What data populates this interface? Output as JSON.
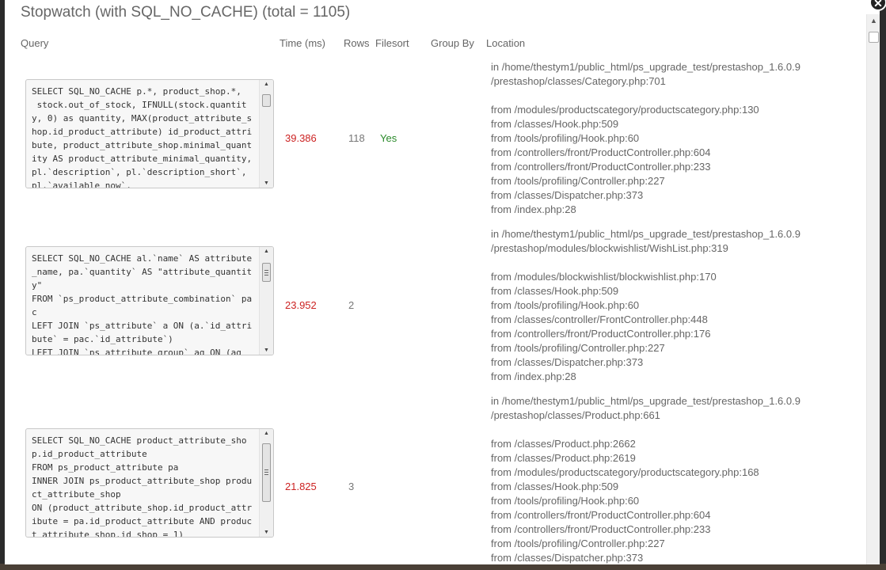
{
  "title": "Stopwatch (with SQL_NO_CACHE) (total = 1105)",
  "headers": {
    "query": "Query",
    "time": "Time (ms)",
    "rows": "Rows",
    "filesort": "Filesort",
    "group_by": "Group By",
    "location": "Location"
  },
  "entries": [
    {
      "sql": "SELECT SQL_NO_CACHE p.*, product_shop.*,\n stock.out_of_stock, IFNULL(stock.quantity, 0) as quantity, MAX(product_attribute_shop.id_product_attribute) id_product_attribute, product_attribute_shop.minimal_quantity AS product_attribute_minimal_quantity, pl.`description`, pl.`description_short`, pl.`available_now`,",
      "time": "39.386",
      "rows": "118",
      "filesort": "Yes",
      "group_by": "",
      "location": "in /home/thestym1/public_html/ps_upgrade_test/prestashop_1.6.0.9\n/prestashop/classes/Category.php:701\n\nfrom /modules/productscategory/productscategory.php:130\nfrom /classes/Hook.php:509\nfrom /tools/profiling/Hook.php:60\nfrom /controllers/front/ProductController.php:604\nfrom /controllers/front/ProductController.php:233\nfrom /tools/profiling/Controller.php:227\nfrom /classes/Dispatcher.php:373\nfrom /index.php:28"
    },
    {
      "sql": "SELECT SQL_NO_CACHE al.`name` AS attribute_name, pa.`quantity` AS \"attribute_quantity\"\nFROM `ps_product_attribute_combination` pac\nLEFT JOIN `ps_attribute` a ON (a.`id_attribute` = pac.`id_attribute`)\nLEFT JOIN `ps_attribute_group` ag ON (ag",
      "time": "23.952",
      "rows": "2",
      "filesort": "",
      "group_by": "",
      "location": "in /home/thestym1/public_html/ps_upgrade_test/prestashop_1.6.0.9\n/prestashop/modules/blockwishlist/WishList.php:319\n\nfrom /modules/blockwishlist/blockwishlist.php:170\nfrom /classes/Hook.php:509\nfrom /tools/profiling/Hook.php:60\nfrom /classes/controller/FrontController.php:448\nfrom /controllers/front/ProductController.php:176\nfrom /tools/profiling/Controller.php:227\nfrom /classes/Dispatcher.php:373\nfrom /index.php:28"
    },
    {
      "sql": "SELECT SQL_NO_CACHE product_attribute_shop.id_product_attribute\nFROM ps_product_attribute pa\nINNER JOIN ps_product_attribute_shop product_attribute_shop\nON (product_attribute_shop.id_product_attribute = pa.id_product_attribute AND product_attribute_shop.id_shop = 1)",
      "time": "21.825",
      "rows": "3",
      "filesort": "",
      "group_by": "",
      "location": "in /home/thestym1/public_html/ps_upgrade_test/prestashop_1.6.0.9\n/prestashop/classes/Product.php:661\n\nfrom /classes/Product.php:2662\nfrom /classes/Product.php:2619\nfrom /modules/productscategory/productscategory.php:168\nfrom /classes/Hook.php:509\nfrom /tools/profiling/Hook.php:60\nfrom /controllers/front/ProductController.php:604\nfrom /controllers/front/ProductController.php:233\nfrom /tools/profiling/Controller.php:227\nfrom /classes/Dispatcher.php:373"
    }
  ]
}
